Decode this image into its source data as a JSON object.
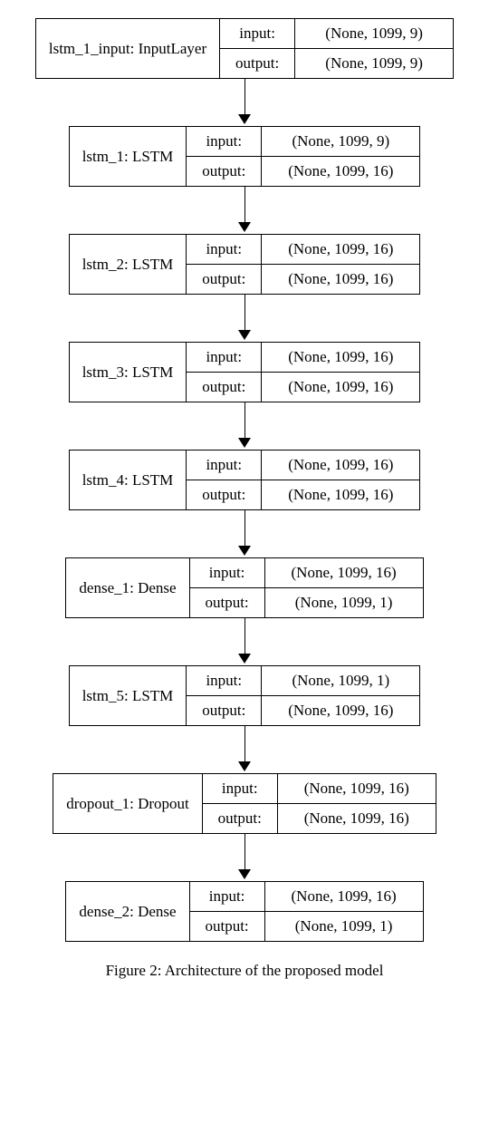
{
  "labels": {
    "input": "input:",
    "output": "output:"
  },
  "caption": "Figure 2: Architecture of the proposed model",
  "layers": [
    {
      "name": "lstm_1_input: InputLayer",
      "input": "(None, 1099, 9)",
      "output": "(None, 1099, 9)"
    },
    {
      "name": "lstm_1: LSTM",
      "input": "(None, 1099, 9)",
      "output": "(None, 1099, 16)"
    },
    {
      "name": "lstm_2: LSTM",
      "input": "(None, 1099, 16)",
      "output": "(None, 1099, 16)"
    },
    {
      "name": "lstm_3: LSTM",
      "input": "(None, 1099, 16)",
      "output": "(None, 1099, 16)"
    },
    {
      "name": "lstm_4: LSTM",
      "input": "(None, 1099, 16)",
      "output": "(None, 1099, 16)"
    },
    {
      "name": "dense_1: Dense",
      "input": "(None, 1099, 16)",
      "output": "(None, 1099, 1)"
    },
    {
      "name": "lstm_5: LSTM",
      "input": "(None, 1099, 1)",
      "output": "(None, 1099, 16)"
    },
    {
      "name": "dropout_1: Dropout",
      "input": "(None, 1099, 16)",
      "output": "(None, 1099, 16)"
    },
    {
      "name": "dense_2: Dense",
      "input": "(None, 1099, 16)",
      "output": "(None, 1099, 1)"
    }
  ]
}
